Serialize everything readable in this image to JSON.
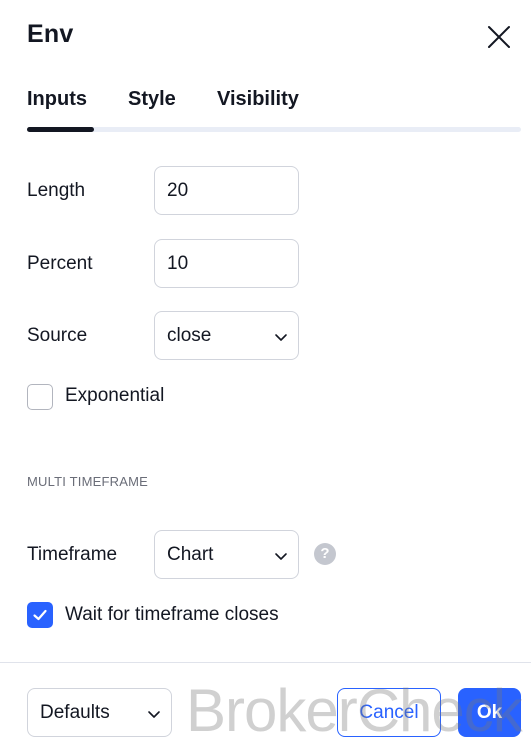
{
  "dialog": {
    "title": "Env",
    "close_icon": "close-icon"
  },
  "tabs": [
    {
      "label": "Inputs",
      "active": true
    },
    {
      "label": "Style",
      "active": false
    },
    {
      "label": "Visibility",
      "active": false
    }
  ],
  "inputs": {
    "length": {
      "label": "Length",
      "value": "20"
    },
    "percent": {
      "label": "Percent",
      "value": "10"
    },
    "source": {
      "label": "Source",
      "value": "close"
    },
    "exponential": {
      "label": "Exponential",
      "checked": false
    }
  },
  "multi_timeframe": {
    "section_title": "MULTI TIMEFRAME",
    "timeframe": {
      "label": "Timeframe",
      "value": "Chart",
      "help_icon": "question-icon",
      "help_glyph": "?"
    },
    "wait_closes": {
      "label": "Wait for timeframe closes",
      "checked": true
    }
  },
  "footer": {
    "defaults_label": "Defaults",
    "cancel_label": "Cancel",
    "ok_label": "Ok"
  },
  "watermark": "BrokerCheck",
  "colors": {
    "accent": "#2962ff",
    "text": "#131722",
    "border": "#d1d4dc"
  }
}
